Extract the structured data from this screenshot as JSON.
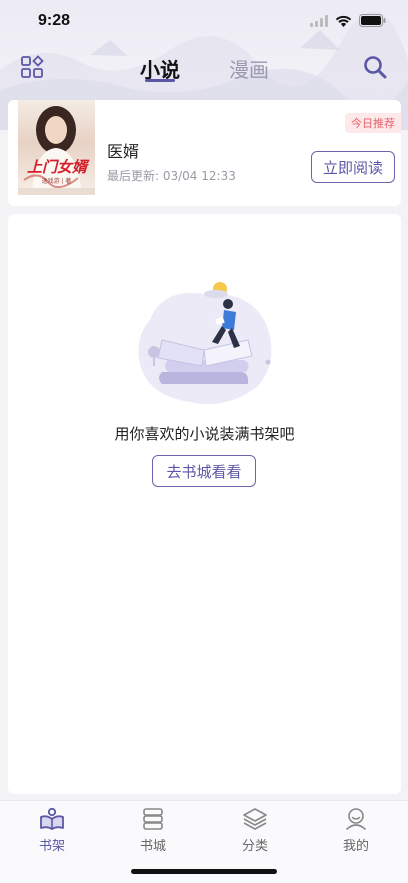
{
  "status_bar": {
    "time": "9:28"
  },
  "nav": {
    "tabs": [
      {
        "label": "小说",
        "active": true
      },
      {
        "label": "漫画",
        "active": false
      }
    ]
  },
  "recommendation": {
    "badge": "今日推荐",
    "title": "医婿",
    "update_label": "最后更新: ",
    "update_time": "03/04 12:33",
    "read_button": "立即阅读",
    "cover_title": "上门女婿",
    "cover_author": "逸戏游 | 著"
  },
  "shelf": {
    "empty_text": "用你喜欢的小说装满书架吧",
    "goto_button": "去书城看看"
  },
  "tabbar": {
    "items": [
      {
        "label": "书架",
        "icon": "bookshelf-icon",
        "active": true
      },
      {
        "label": "书城",
        "icon": "bookstore-icon",
        "active": false
      },
      {
        "label": "分类",
        "icon": "category-icon",
        "active": false
      },
      {
        "label": "我的",
        "icon": "profile-icon",
        "active": false
      }
    ]
  },
  "colors": {
    "accent": "#5b57a6",
    "badge_text": "#e6626b",
    "badge_bg": "#fde9ea"
  }
}
